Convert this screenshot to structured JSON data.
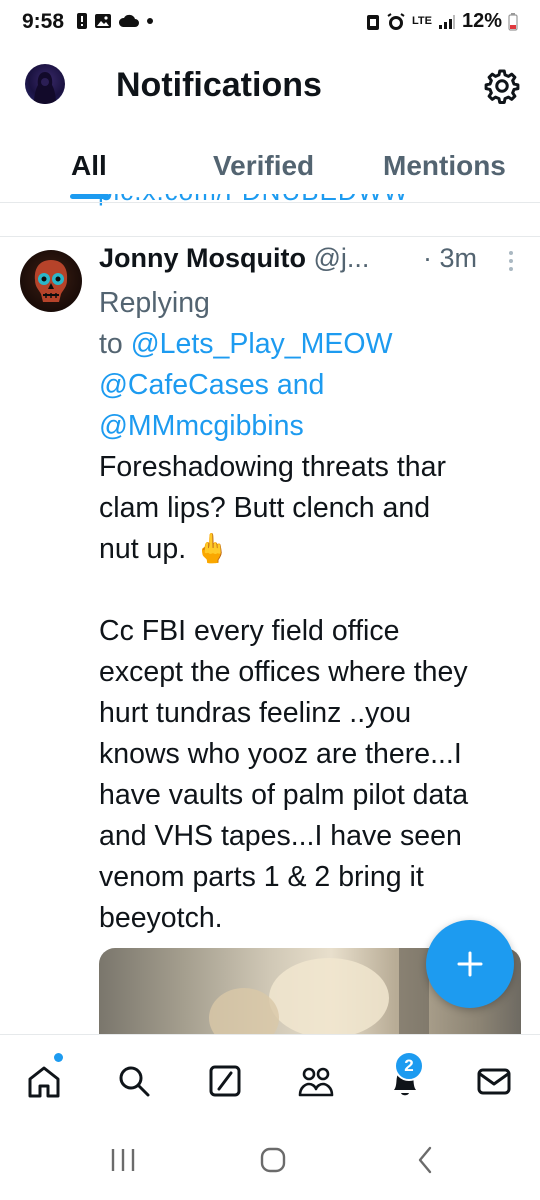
{
  "status_bar": {
    "time": "9:58",
    "battery": "12%",
    "network": "LTE"
  },
  "header": {
    "title": "Notifications"
  },
  "tabs": [
    {
      "label": "All",
      "active": true
    },
    {
      "label": "Verified",
      "active": false
    },
    {
      "label": "Mentions",
      "active": false
    }
  ],
  "cut_text": "pic.x.com/FDNUBEDWW",
  "tweet": {
    "name": "Jonny Mosquito",
    "handle": "@j...",
    "time": "· 3m",
    "replying_prefix": "Replying",
    "replying_to": "to",
    "mention1": "@Lets_Play_MEOW",
    "mention2": "@CafeCases",
    "and": "and",
    "mention3": "@MMmcgibbins",
    "body_lines_1": [
      "Foreshadowing threats thar",
      "clam lips?  Butt clench and",
      "nut up. 🖕"
    ],
    "body_lines_2": [
      "Cc FBI every field office",
      "except the offices where they",
      "hurt tundras feelinz ..you",
      "knows who yooz are there...I",
      "have vaults of palm pilot data",
      "and VHS tapes...I have seen",
      "venom parts 1 & 2 bring it",
      "beeyotch."
    ]
  },
  "bottom_nav": {
    "notification_badge": "2"
  },
  "colors": {
    "accent": "#1d9bf0",
    "text": "#0f1419",
    "muted": "#536471"
  }
}
